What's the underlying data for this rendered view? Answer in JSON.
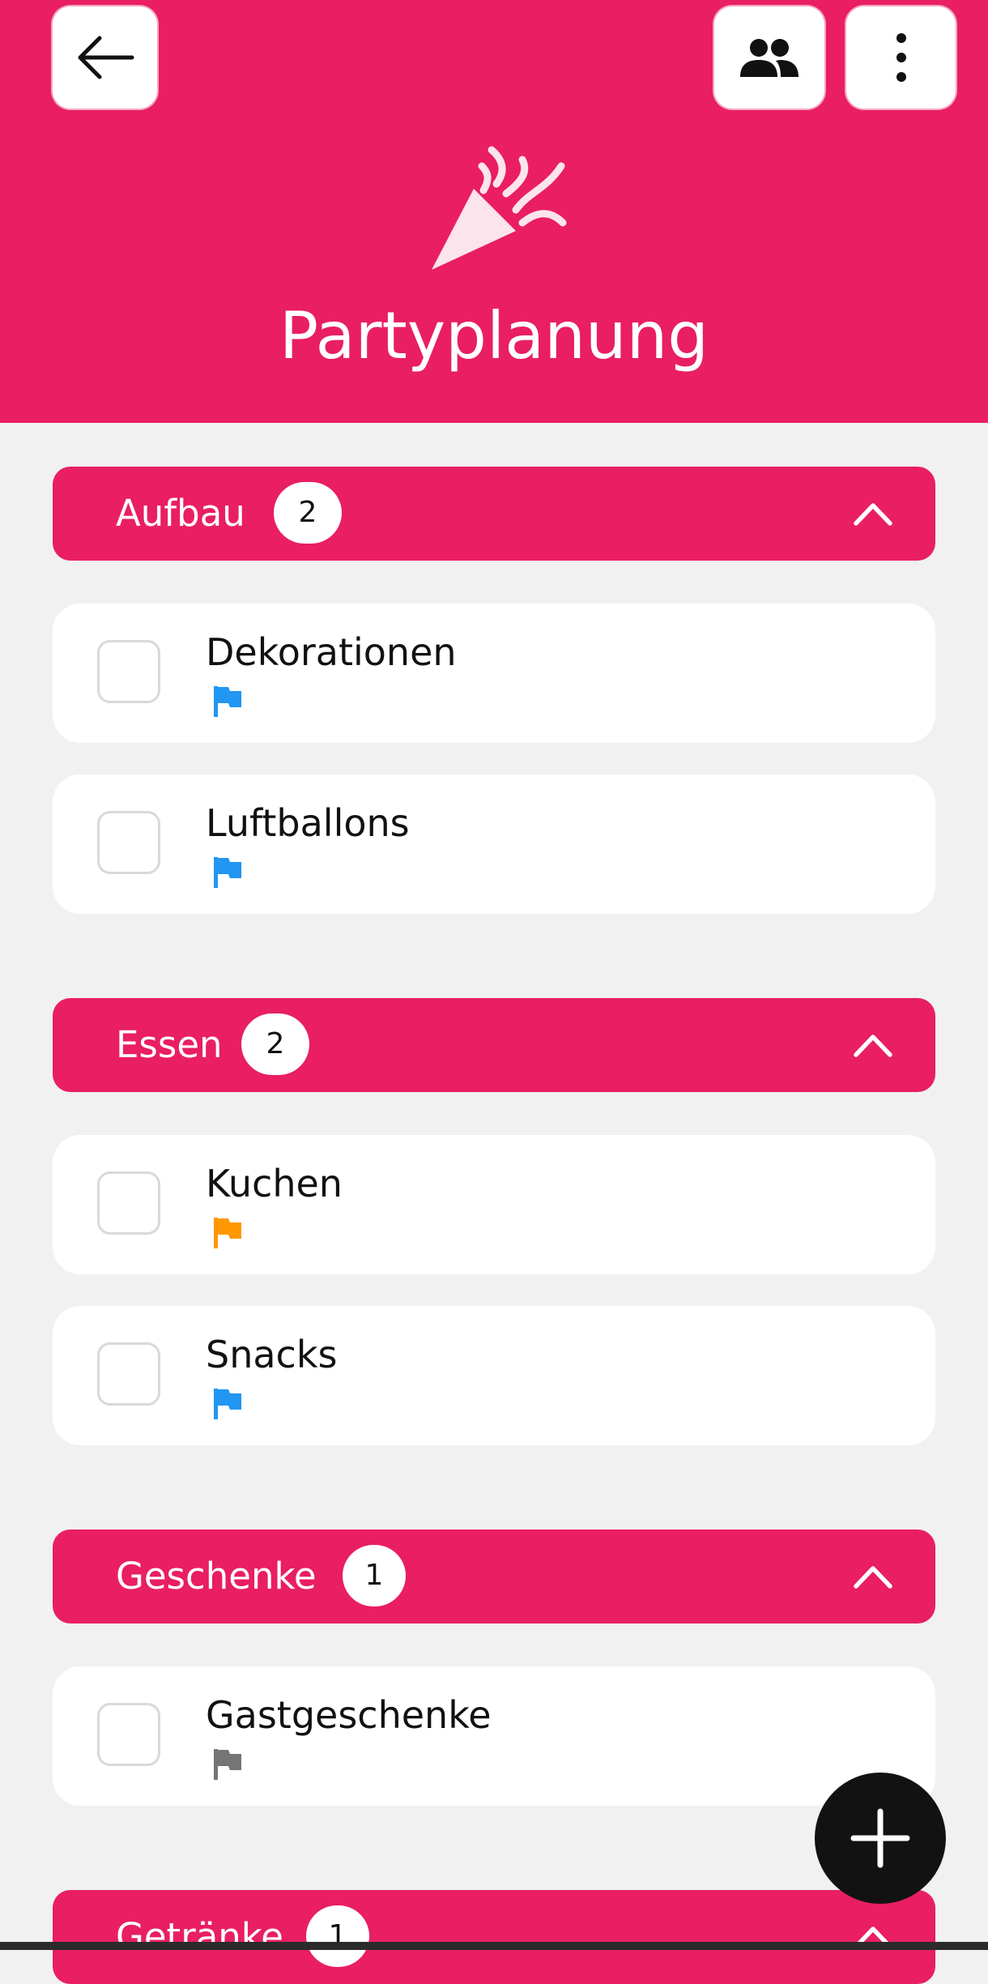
{
  "header": {
    "title": "Partyplanung",
    "back_icon": "arrow-left-icon",
    "members_icon": "people-icon",
    "more_icon": "more-vertical-icon",
    "list_icon": "party-popper-icon",
    "color": "#e91e63"
  },
  "groups": [
    {
      "name": "Aufbau",
      "count": "2",
      "expanded": true,
      "items": [
        {
          "title": "Dekorationen",
          "checked": false,
          "flag_color": "#2196f3"
        },
        {
          "title": "Luftballons",
          "checked": false,
          "flag_color": "#2196f3"
        }
      ]
    },
    {
      "name": "Essen",
      "count": "2",
      "expanded": true,
      "items": [
        {
          "title": "Kuchen",
          "checked": false,
          "flag_color": "#ff9800"
        },
        {
          "title": "Snacks",
          "checked": false,
          "flag_color": "#2196f3"
        }
      ]
    },
    {
      "name": "Geschenke",
      "count": "1",
      "expanded": true,
      "items": [
        {
          "title": "Gastgeschenke",
          "checked": false,
          "flag_color": "#757575"
        }
      ]
    },
    {
      "name": "Getränke",
      "count": "1",
      "expanded": true,
      "items": []
    }
  ],
  "fab": {
    "icon": "plus-icon"
  }
}
